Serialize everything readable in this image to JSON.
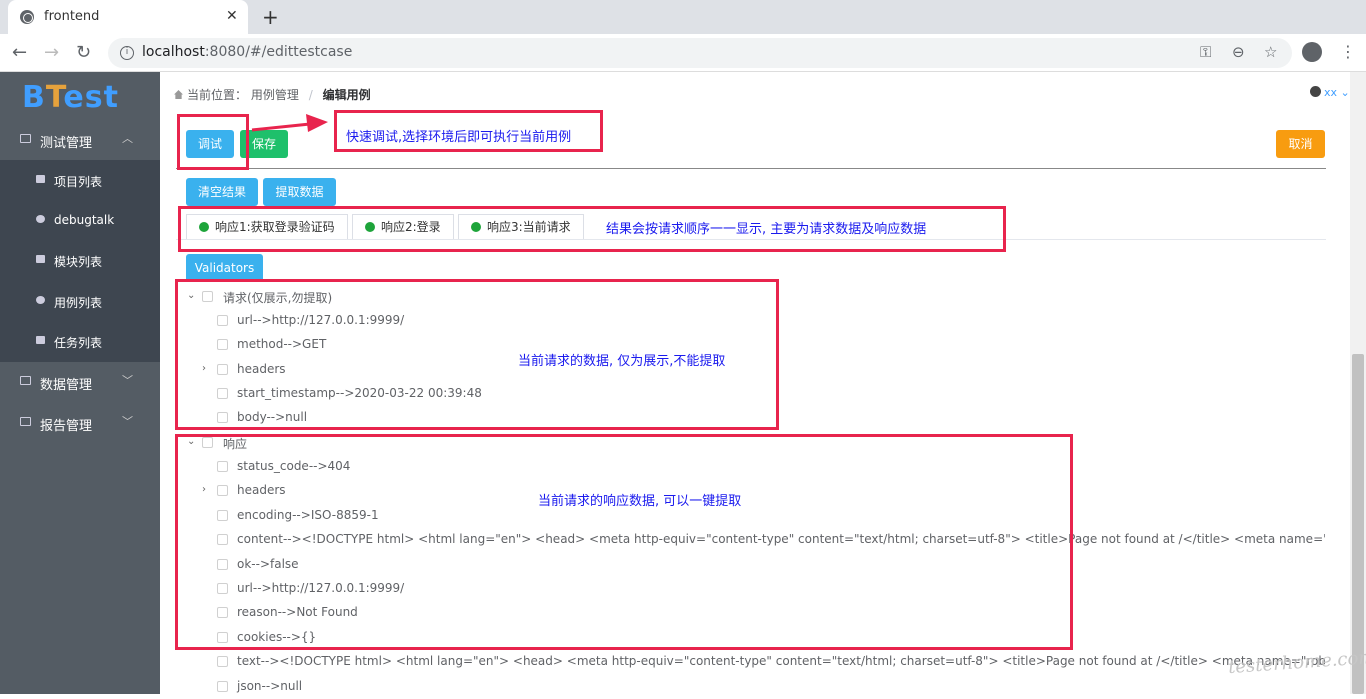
{
  "browser": {
    "tab_title": "frontend",
    "url_host": "localhost",
    "url_rest": ":8080/#/edittestcase"
  },
  "sidebar": {
    "logo_b": "B",
    "logo_t": "T",
    "logo_rest": "est",
    "groups": [
      {
        "label": "测试管理",
        "icon": "monitor-icon",
        "expanded": true
      },
      {
        "label": "数据管理",
        "icon": "layers-icon",
        "expanded": false
      },
      {
        "label": "报告管理",
        "icon": "chart-icon",
        "expanded": false
      }
    ],
    "items": [
      {
        "label": "项目列表",
        "icon": "folder-icon"
      },
      {
        "label": "debugtalk",
        "icon": "disc-icon"
      },
      {
        "label": "模块列表",
        "icon": "grid-icon"
      },
      {
        "label": "用例列表",
        "icon": "bug-icon"
      },
      {
        "label": "任务列表",
        "icon": "calendar-icon"
      }
    ]
  },
  "breadcrumb": {
    "prefix": "当前位置：",
    "parent": "用例管理",
    "sep": "/",
    "current": "编辑用例"
  },
  "user": {
    "name": "xx"
  },
  "toolbar": {
    "debug": "调试",
    "save": "保存",
    "cancel": "取消",
    "clear": "清空结果",
    "extract": "提取数据",
    "validators": "Validators"
  },
  "tabs": [
    {
      "label": "响应1:获取登录验证码"
    },
    {
      "label": "响应2:登录"
    },
    {
      "label": "响应3:当前请求"
    }
  ],
  "annotations": {
    "debug": "快速调试,选择环境后即可执行当前用例",
    "tabs": "结果会按请求顺序一一显示, 主要为请求数据及响应数据",
    "request": "当前请求的数据, 仅为展示,不能提取",
    "response": "当前请求的响应数据, 可以一键提取"
  },
  "tree": {
    "request": {
      "label": "请求(仅展示,勿提取)",
      "children": [
        "url-->http://127.0.0.1:9999/",
        "method-->GET",
        "headers",
        "start_timestamp-->2020-03-22 00:39:48",
        "body-->null"
      ]
    },
    "response": {
      "label": "响应",
      "children": [
        "status_code-->404",
        "headers",
        "encoding-->ISO-8859-1",
        "content--><!DOCTYPE html> <html lang=\"en\"> <head> <meta http-equiv=\"content-type\" content=\"text/html; charset=utf-8\"> <title>Page not found at /</title> <meta name=\"robots\" content=\"NONE,NOARCHIVE\">",
        "ok-->false",
        "url-->http://127.0.0.1:9999/",
        "reason-->Not Found",
        "cookies-->{}",
        "text--><!DOCTYPE html> <html lang=\"en\"> <head> <meta http-equiv=\"content-type\" content=\"text/html; charset=utf-8\"> <title>Page not found at /</title> <meta name=\"robots\" content=\"NONE,NOARCHIVE\">",
        "json-->null"
      ]
    }
  },
  "watermark": "testerhome.com"
}
